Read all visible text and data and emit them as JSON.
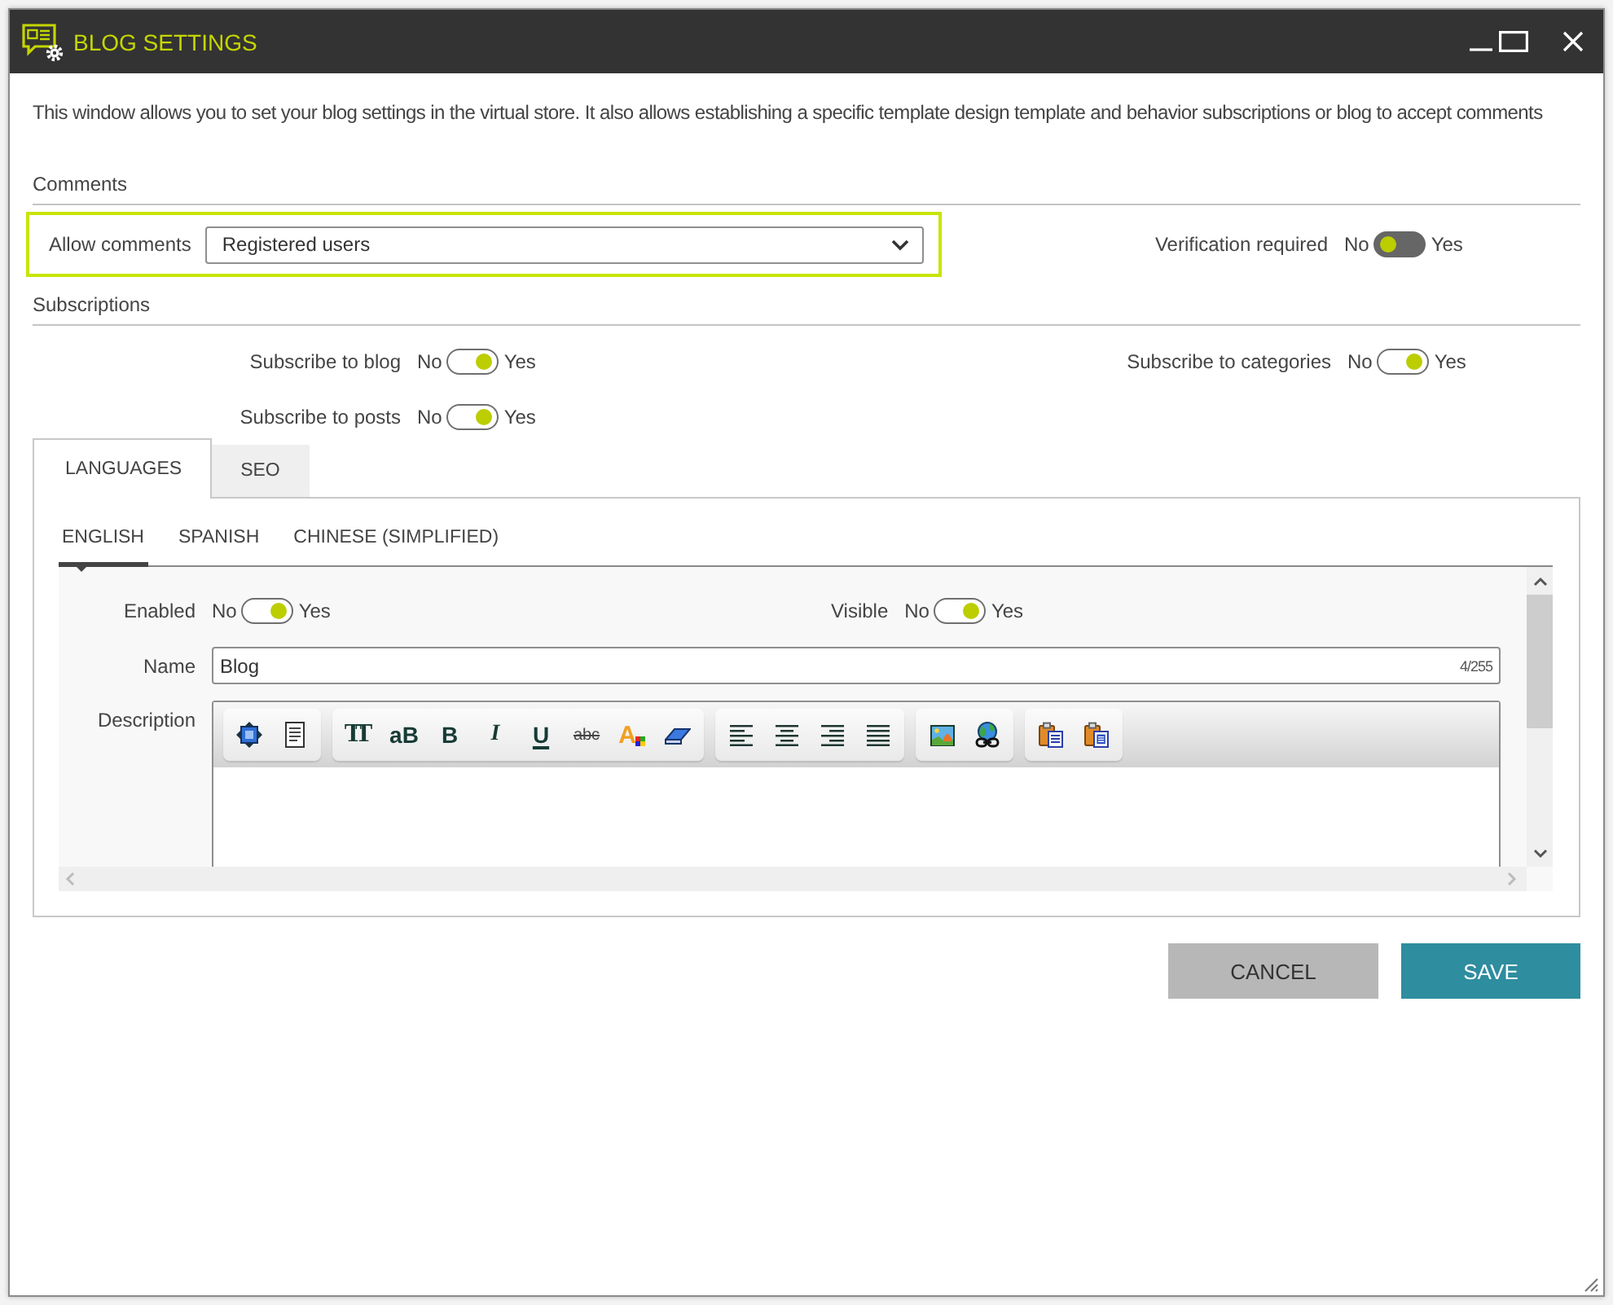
{
  "window": {
    "title": "BLOG SETTINGS"
  },
  "intro": "This window allows you to set your blog settings in the virtual store. It also allows establishing a specific template design template and behavior subscriptions or blog to accept comments",
  "comments": {
    "heading": "Comments",
    "allow_comments": {
      "label": "Allow comments",
      "value": "Registered users",
      "focused": true
    },
    "verification": {
      "label": "Verification required",
      "off_label": "No",
      "on_label": "Yes",
      "on": false
    }
  },
  "subscriptions": {
    "heading": "Subscriptions",
    "switches": [
      {
        "label": "Subscribe to blog",
        "off_label": "No",
        "on_label": "Yes",
        "on": true
      },
      {
        "label": "Subscribe to categories",
        "off_label": "No",
        "on_label": "Yes",
        "on": true
      },
      {
        "label": "Subscribe to posts",
        "off_label": "No",
        "on_label": "Yes",
        "on": true
      }
    ]
  },
  "tabs": [
    {
      "label": "LANGUAGES",
      "selected": true
    },
    {
      "label": "SEO",
      "selected": false
    }
  ],
  "language_tabs": [
    {
      "label": "ENGLISH",
      "selected": true
    },
    {
      "label": "SPANISH",
      "selected": false
    },
    {
      "label": "CHINESE (SIMPLIFIED)",
      "selected": false
    }
  ],
  "language_form": {
    "enabled": {
      "label": "Enabled",
      "off_label": "No",
      "on_label": "Yes",
      "on": true
    },
    "visible": {
      "label": "Visible",
      "off_label": "No",
      "on_label": "Yes",
      "on": true
    },
    "name": {
      "label": "Name",
      "value": "Blog",
      "counter": "4/255"
    },
    "description": {
      "label": "Description",
      "toolbar": [
        {
          "buttons": [
            {
              "kind": "source"
            },
            {
              "kind": "template"
            }
          ]
        },
        {
          "buttons": [
            {
              "kind": "font-size",
              "glyph": "TT"
            },
            {
              "kind": "case",
              "glyph": "aB"
            },
            {
              "kind": "bold",
              "glyph": "B"
            },
            {
              "kind": "italic",
              "glyph": "I"
            },
            {
              "kind": "underline",
              "glyph": "U"
            },
            {
              "kind": "strike",
              "glyph": "abc"
            },
            {
              "kind": "color",
              "glyph": "A"
            },
            {
              "kind": "eraser"
            }
          ]
        },
        {
          "buttons": [
            {
              "kind": "align-left"
            },
            {
              "kind": "align-center"
            },
            {
              "kind": "align-right"
            },
            {
              "kind": "justify"
            }
          ]
        },
        {
          "buttons": [
            {
              "kind": "image"
            },
            {
              "kind": "link"
            }
          ]
        },
        {
          "buttons": [
            {
              "kind": "paste"
            },
            {
              "kind": "paste-word"
            }
          ]
        }
      ]
    }
  },
  "buttons": [
    {
      "label": "CANCEL",
      "kind": "secondary"
    },
    {
      "label": "SAVE",
      "kind": "primary"
    }
  ]
}
